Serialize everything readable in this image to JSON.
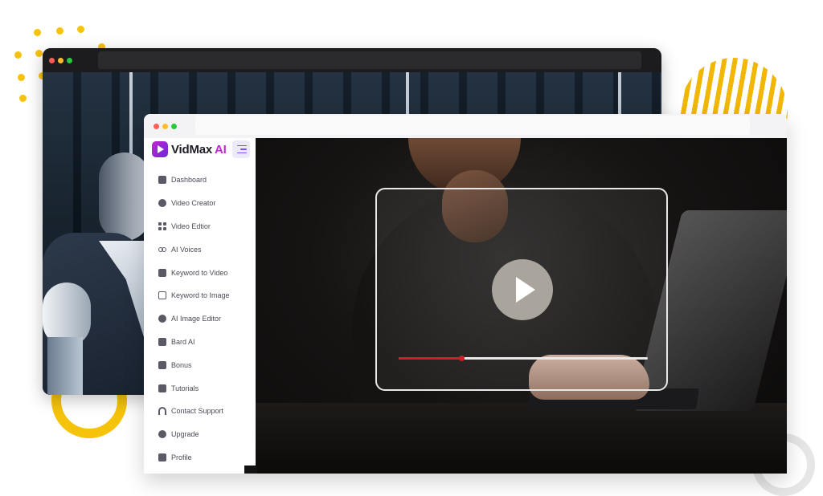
{
  "colors": {
    "brand": "#c026d3",
    "accent_yellow": "#f5c30a",
    "progress_red": "#d11f2a",
    "traffic_red": "#ff5f57",
    "traffic_yellow": "#febc2e",
    "traffic_green": "#28c840"
  },
  "app": {
    "logo_name": "VidMax",
    "logo_suffix": "AI"
  },
  "sidebar": {
    "items": [
      {
        "label": "Dashboard",
        "icon": "home-icon"
      },
      {
        "label": "Video Creator",
        "icon": "globe-icon"
      },
      {
        "label": "Video Edtior",
        "icon": "grid-icon"
      },
      {
        "label": "AI Voices",
        "icon": "voicemail-icon"
      },
      {
        "label": "Keyword to Video",
        "icon": "chat-icon"
      },
      {
        "label": "Keyword to Image",
        "icon": "image-icon"
      },
      {
        "label": "AI Image Editor",
        "icon": "fingerprint-icon"
      },
      {
        "label": "Bard AI",
        "icon": "book-icon"
      },
      {
        "label": "Bonus",
        "icon": "gift-icon"
      },
      {
        "label": "Tutorials",
        "icon": "play-square-icon"
      },
      {
        "label": "Contact Support",
        "icon": "headphones-icon"
      },
      {
        "label": "Upgrade",
        "icon": "rocket-icon"
      },
      {
        "label": "Profile",
        "icon": "id-card-icon"
      }
    ]
  },
  "player": {
    "progress": 0.25
  }
}
